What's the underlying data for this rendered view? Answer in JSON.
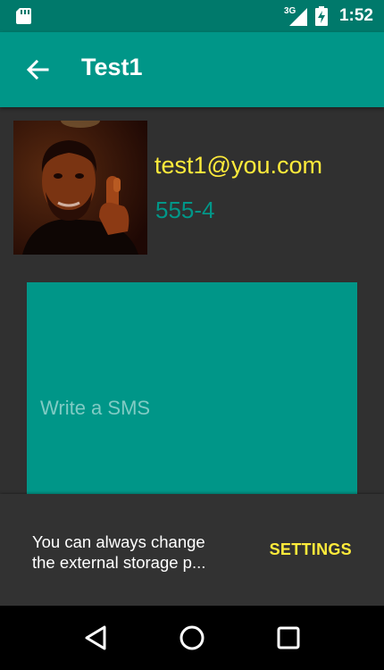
{
  "status_bar": {
    "network": "3G",
    "time": "1:52",
    "icons": [
      "sd-card-icon",
      "signal-icon",
      "battery-charging-icon"
    ]
  },
  "app_bar": {
    "title": "Test1",
    "back_icon": "arrow-back-icon"
  },
  "contact": {
    "email": "test1@you.com",
    "phone": "555-4"
  },
  "sms": {
    "placeholder": "Write a SMS",
    "value": ""
  },
  "snackbar": {
    "message": "You can always change\nthe external storage p...",
    "action": "SETTINGS"
  },
  "nav_bar": {
    "icons": [
      "back-triangle-icon",
      "home-circle-icon",
      "recents-square-icon"
    ]
  },
  "colors": {
    "primary": "#009688",
    "primary_dark": "#00796b",
    "accent": "#ffeb3b",
    "background": "#303030"
  }
}
